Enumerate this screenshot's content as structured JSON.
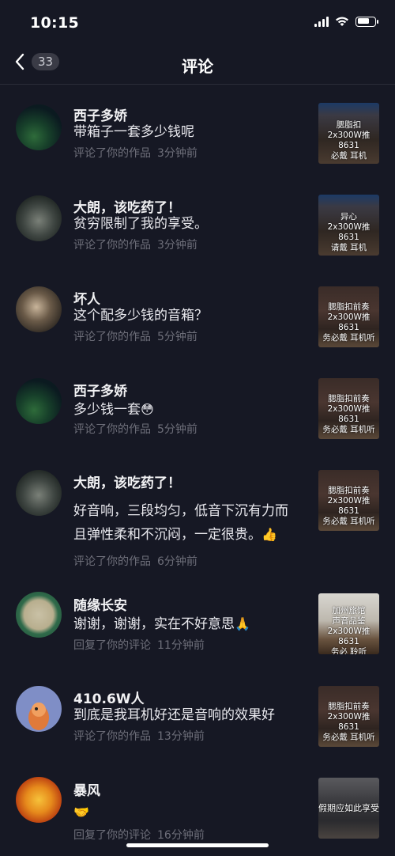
{
  "status": {
    "time": "10:15"
  },
  "nav": {
    "count": "33",
    "title": "评论"
  },
  "comments": [
    {
      "name": "西子多娇",
      "text": "带箱子一套多少钱呢",
      "action": "评论了你的作品",
      "time": "3分钟前",
      "thumb": {
        "lines": [
          "腮脂扣",
          "2x300W推8631",
          "必戴   耳机"
        ]
      }
    },
    {
      "name": "大朗，该吃药了！",
      "text": "贫穷限制了我的享受。",
      "action": "评论了你的作品",
      "time": "3分钟前",
      "thumb": {
        "lines": [
          "异心",
          "2x300W推8631",
          "请戴   耳机"
        ]
      }
    },
    {
      "name": "坏人",
      "text": "这个配多少钱的音箱？",
      "action": "评论了你的作品",
      "time": "5分钟前",
      "thumb": {
        "lines": [
          "腮脂扣前奏",
          "2x300W推8631",
          "务必戴  耳机听"
        ]
      }
    },
    {
      "name": "西子多娇",
      "text": "多少钱一套",
      "emoji": "😳",
      "action": "评论了你的作品",
      "time": "5分钟前",
      "thumb": {
        "lines": [
          "腮脂扣前奏",
          "2x300W推8631",
          "务必戴  耳机听"
        ]
      }
    },
    {
      "name": "大朗，该吃药了！",
      "text_line1": "好音响，三段均匀，低音下沉有力而",
      "text_line2": "且弹性柔和不沉闷，一定很贵。",
      "emoji": "👍",
      "action": "评论了你的作品",
      "time": "6分钟前",
      "thumb": {
        "lines": [
          "腮脂扣前奏",
          "2x300W推8631",
          "务必戴  耳机听"
        ]
      }
    },
    {
      "name": "随缘长安",
      "text": "谢谢，谢谢，实在不好意思",
      "emoji": "🙏",
      "action": "回复了你的评论",
      "time": "11分钟前",
      "thumb": {
        "lines": [
          "加州旅馆",
          "声音品鉴",
          "2x300W推8631",
          "务必   聆听"
        ]
      }
    },
    {
      "name": "410.6W人",
      "text": "到底是我耳机好还是音响的效果好",
      "action": "评论了你的作品",
      "time": "13分钟前",
      "thumb": {
        "lines": [
          "腮脂扣前奏",
          "2x300W推8631",
          "务必戴  耳机听"
        ]
      }
    },
    {
      "name": "暴风",
      "emoji": "🤝",
      "action": "回复了你的评论",
      "time": "16分钟前",
      "thumb": {
        "lines": [
          "假期应如此享受"
        ]
      }
    }
  ],
  "colors": {
    "background": "#161824",
    "meta": "#6e6f7a",
    "badge": "#3a3b46"
  }
}
